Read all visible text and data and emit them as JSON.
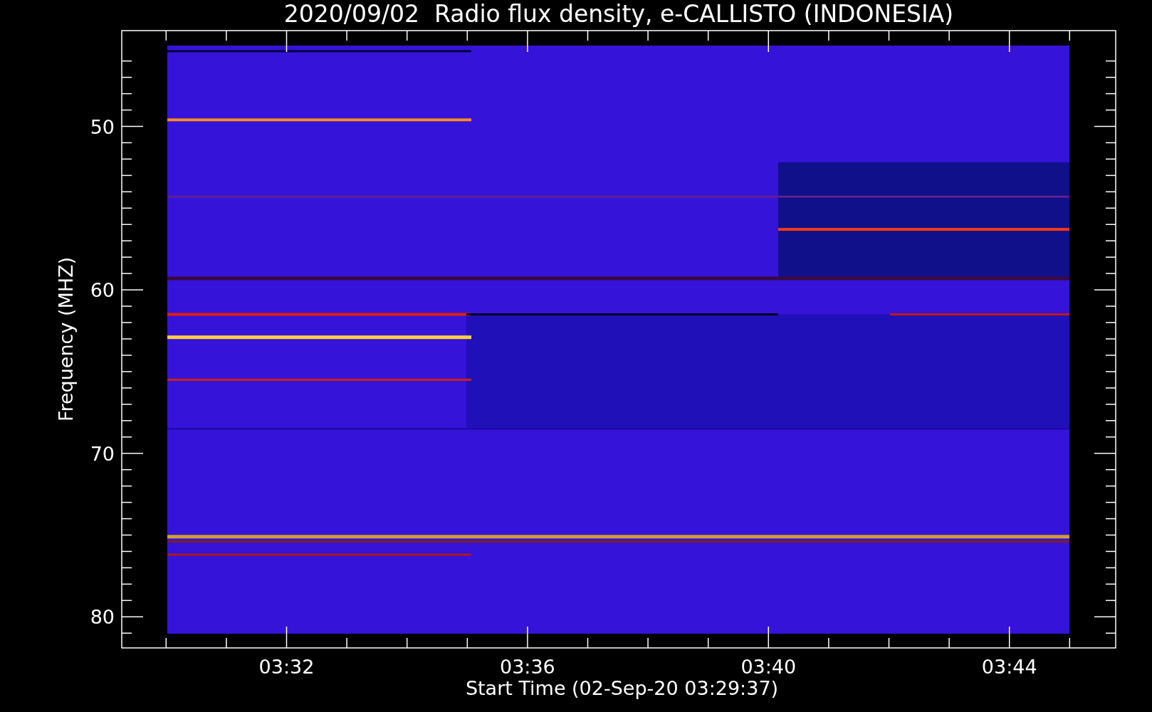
{
  "title": "2020/09/02  Radio flux density, e-CALLISTO (INDONESIA)",
  "y_axis": {
    "label": "Frequency (MHZ)",
    "ticks": [
      "50",
      "60",
      "70",
      "80"
    ]
  },
  "x_axis": {
    "label": "Start Time (02-Sep-20 03:29:37)",
    "ticks": [
      "03:32",
      "03:36",
      "03:40",
      "03:44"
    ]
  }
}
